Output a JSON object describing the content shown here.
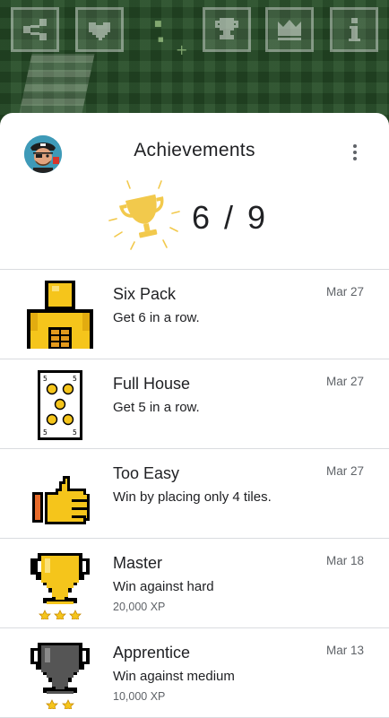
{
  "top_bar": {
    "buttons": [
      {
        "name": "share-button",
        "icon": "share-icon"
      },
      {
        "name": "favorite-button",
        "icon": "heart-icon"
      },
      {
        "name": "trophy-button",
        "icon": "trophy-icon"
      },
      {
        "name": "leaderboard-button",
        "icon": "crown-icon"
      },
      {
        "name": "info-button",
        "icon": "info-icon"
      }
    ]
  },
  "header": {
    "title": "Achievements",
    "avatar_icon": "pirate-avatar-icon",
    "menu_icon": "more-vert-icon"
  },
  "summary": {
    "count": "6 / 9",
    "trophy_color": "#f2c94c"
  },
  "achievements": [
    {
      "name": "Six Pack",
      "description": "Get 6 in a row.",
      "xp": "",
      "date": "Mar 27",
      "icon": "six-pack-icon"
    },
    {
      "name": "Full House",
      "description": "Get 5 in a row.",
      "xp": "",
      "date": "Mar 27",
      "icon": "card-five-icon"
    },
    {
      "name": "Too Easy",
      "description": "Win by placing only 4 tiles.",
      "xp": "",
      "date": "Mar 27",
      "icon": "thumbs-up-icon"
    },
    {
      "name": "Master",
      "description": "Win against hard",
      "xp": "20,000 XP",
      "date": "Mar 18",
      "icon": "gold-trophy-icon"
    },
    {
      "name": "Apprentice",
      "description": "Win against medium",
      "xp": "10,000 XP",
      "date": "Mar 13",
      "icon": "silver-trophy-icon"
    }
  ],
  "colors": {
    "gold": "#f5c51b",
    "gold_outline": "#000000",
    "silver": "#555555",
    "divider": "#dadce0"
  }
}
